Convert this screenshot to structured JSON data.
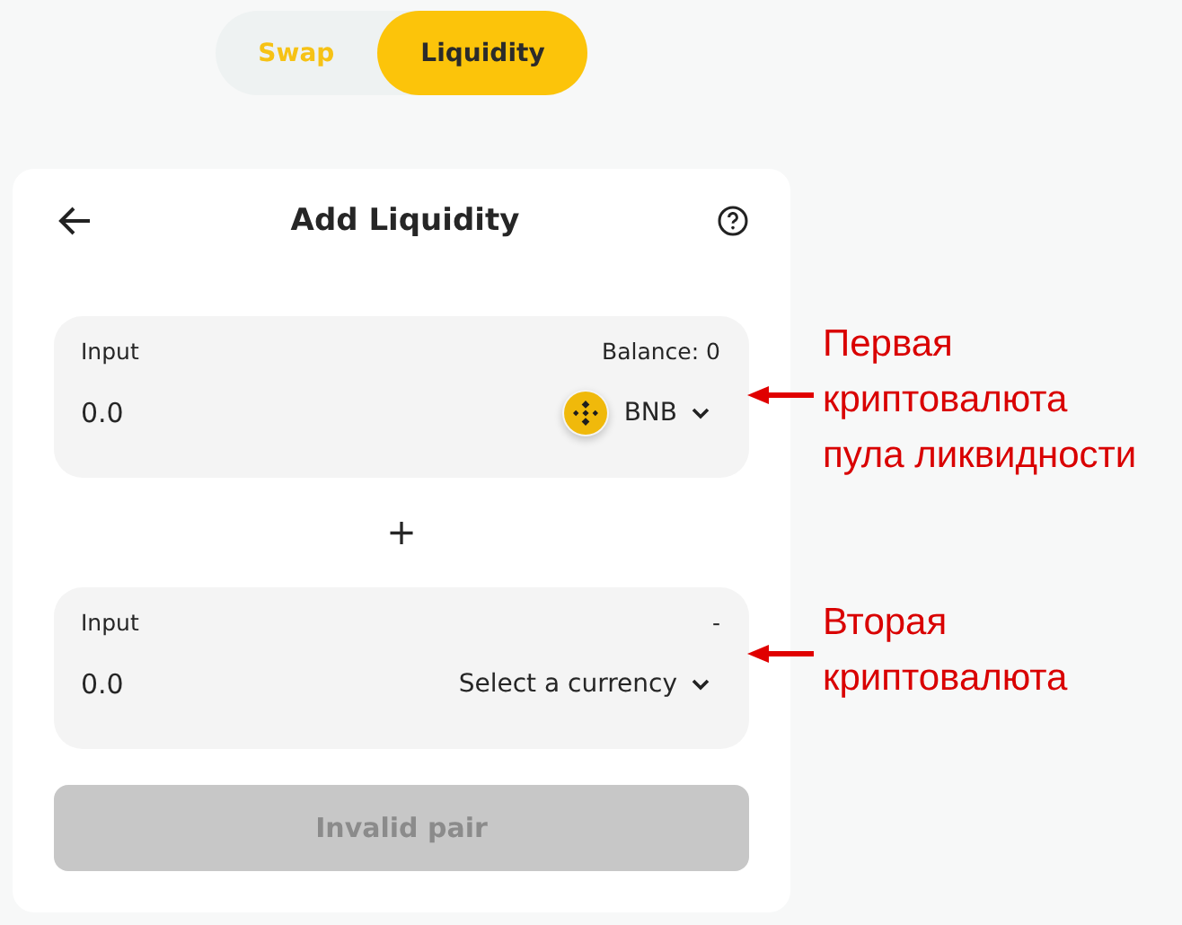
{
  "tabs": [
    {
      "label": "Swap",
      "selected": false
    },
    {
      "label": "Liquidity",
      "selected": true
    }
  ],
  "card": {
    "title": "Add Liquidity",
    "inputs": [
      {
        "kind": "token",
        "label": "Input",
        "balance": "Balance: 0",
        "value": "0.0",
        "currency": "BNB"
      },
      {
        "kind": "select",
        "label": "Input",
        "balance": "-",
        "value": "0.0",
        "currency": "Select a currency"
      }
    ],
    "separator": "+",
    "button": {
      "label": "Invalid pair",
      "disabled": true
    }
  },
  "annotations": [
    {
      "text": "Первая\nкриптовалюта\nпула ликвидности"
    },
    {
      "text": "Вторая\nкриптовалюта"
    }
  ]
}
